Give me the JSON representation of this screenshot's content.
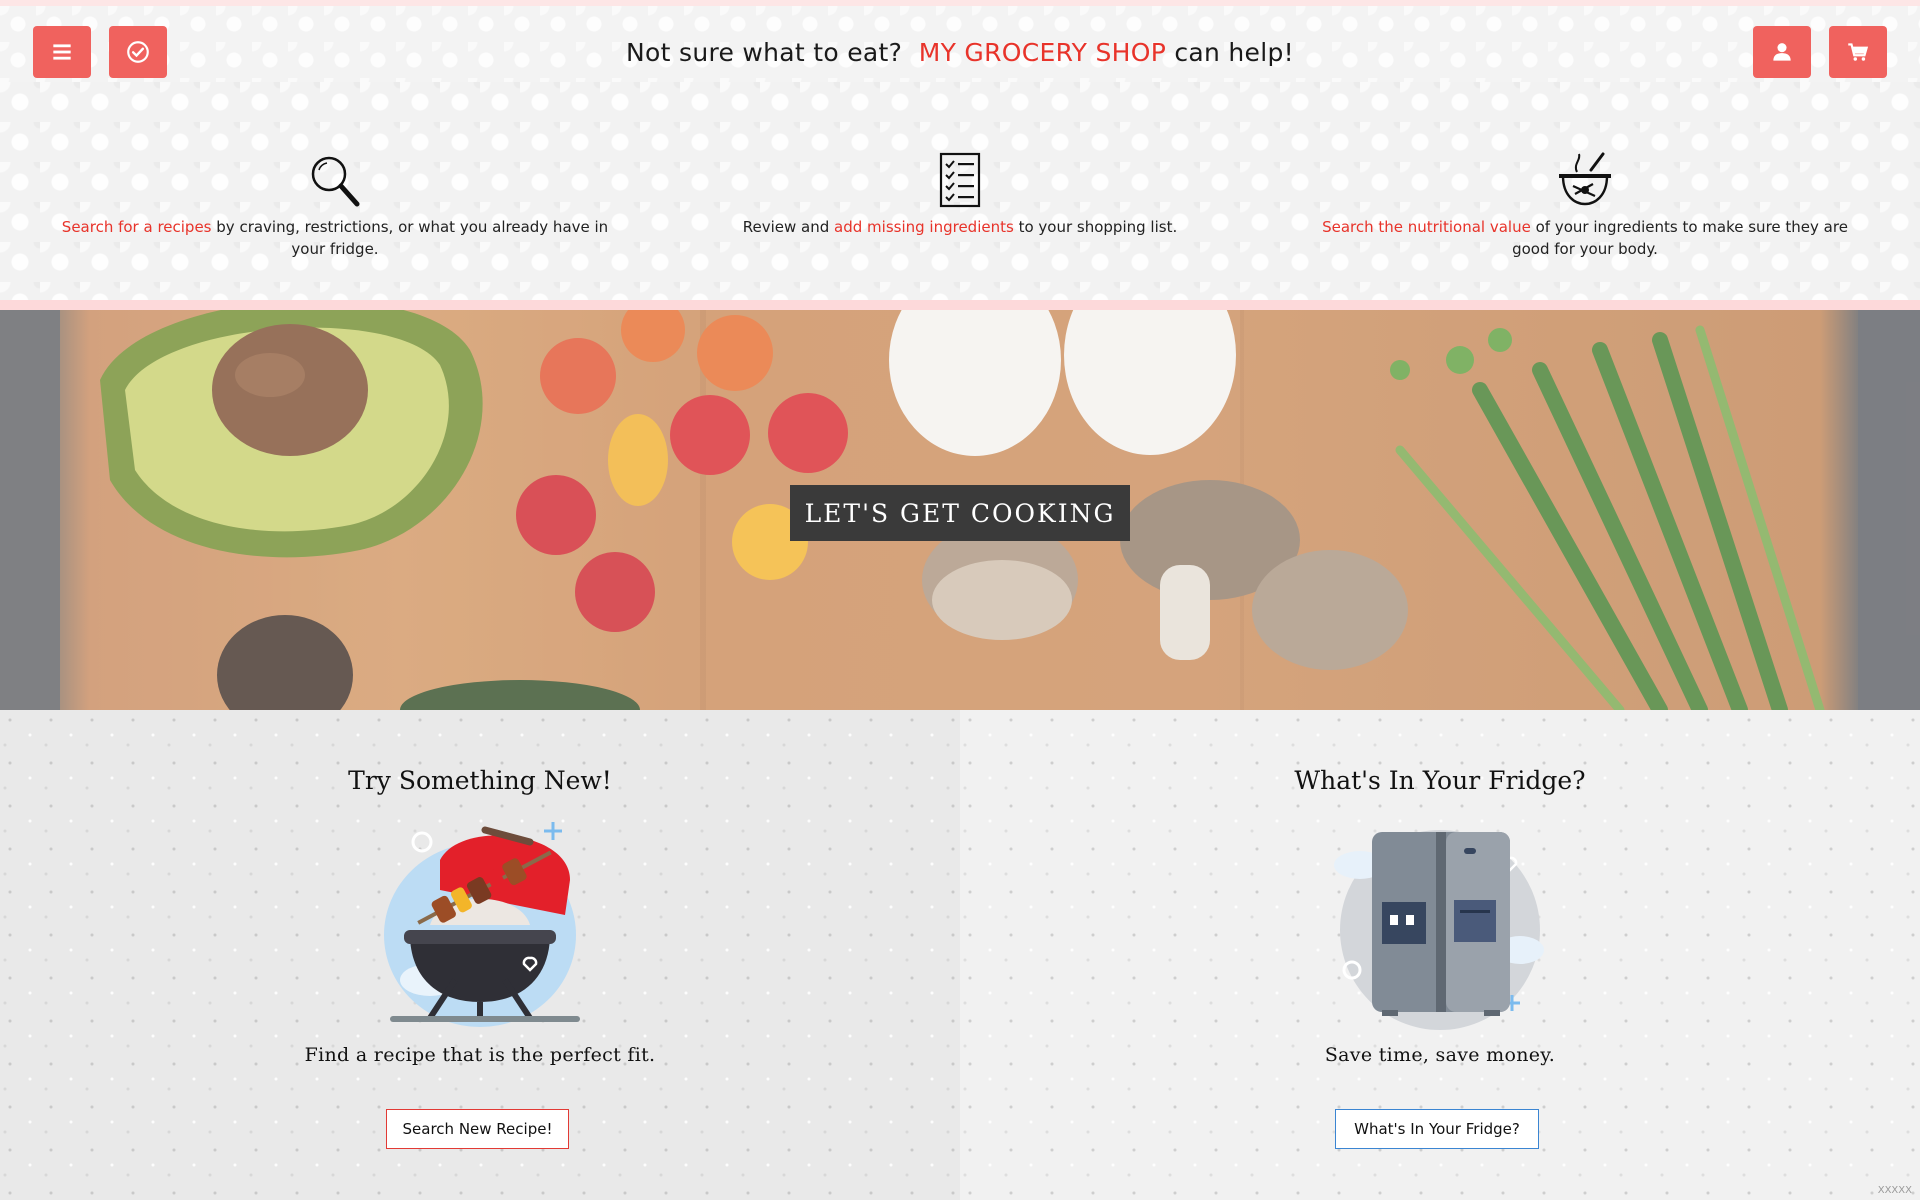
{
  "header": {
    "tagline_before": "Not sure what to eat?",
    "brand": "MY GROCERY SHOP",
    "tagline_after": "can help!",
    "buttons": [
      {
        "name": "menu",
        "icon": "menu-icon"
      },
      {
        "name": "check",
        "icon": "check-circle-icon"
      },
      {
        "name": "user",
        "icon": "user-icon"
      },
      {
        "name": "cart",
        "icon": "cart-icon"
      }
    ],
    "button_color": "#f0625e"
  },
  "features": [
    {
      "icon": "magnifier-icon",
      "link": "Search for a recipes",
      "text": "by craving, restrictions, or what you already have in your fridge."
    },
    {
      "icon": "checklist-icon",
      "before": "Review and",
      "link": "add missing ingredients",
      "text": "to your shopping list."
    },
    {
      "icon": "nutrition-icon",
      "link": "Search the nutritional value",
      "text": "of your ingredients to make sure they are good for your body."
    }
  ],
  "hero": {
    "button_label": "LET'S GET COOKING"
  },
  "cards": {
    "left": {
      "title": "Try Something New!",
      "illustration": "grill-icon",
      "subtitle": "Find a recipe that is the perfect fit.",
      "button_label": "Search New Recipe!",
      "button_border": "#e23a35"
    },
    "right": {
      "title": "What's In Your Fridge?",
      "illustration": "fridge-icon",
      "subtitle": "Save time, save money.",
      "button_label": "What's In Your Fridge?",
      "button_border": "#3b85d2"
    }
  },
  "watermark": "XXXXX",
  "colors": {
    "accent": "#e8332a",
    "divider": "#fdd9da"
  }
}
